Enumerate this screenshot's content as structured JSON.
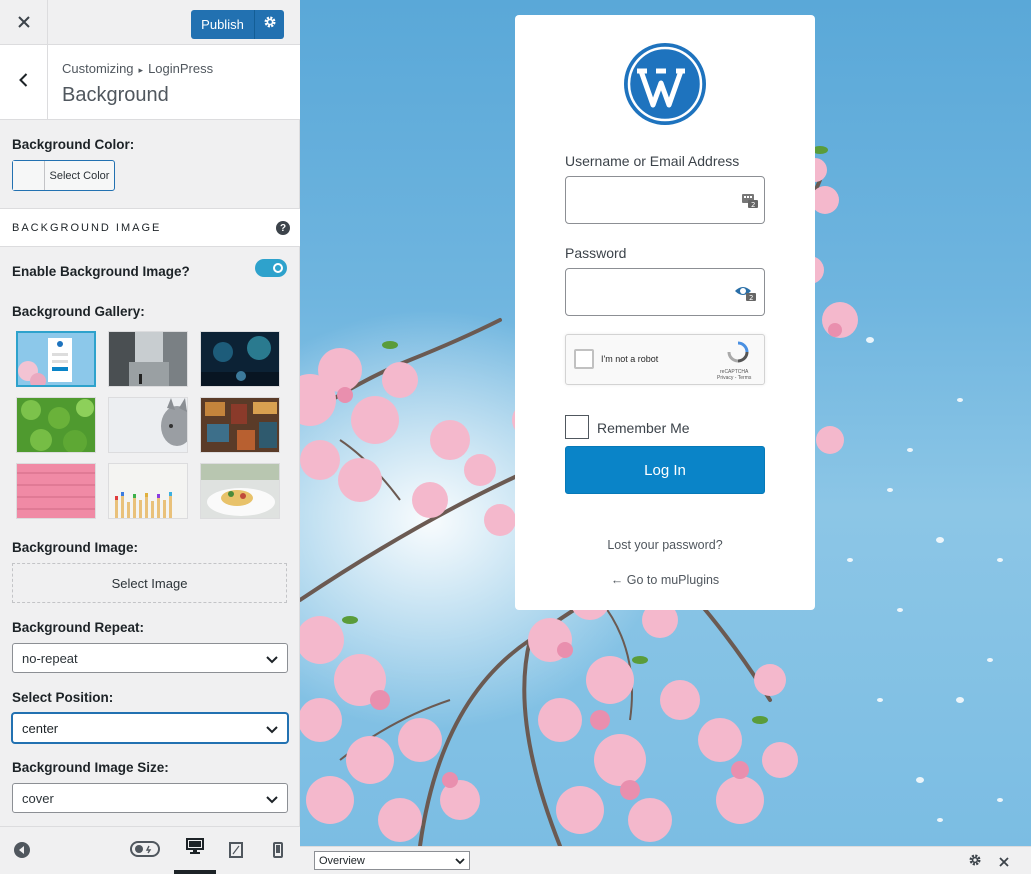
{
  "topbar": {
    "close_icon": "close-icon",
    "publish_label": "Publish",
    "settings_icon": "gear-icon"
  },
  "section": {
    "breadcrumb_parent": "Customizing",
    "breadcrumb_child": "LoginPress",
    "title": "Background"
  },
  "controls": {
    "background_color_label": "Background Color:",
    "select_color_label": "Select Color",
    "background_image_section": "BACKGROUND IMAGE",
    "enable_bg_label": "Enable Background Image?",
    "enable_bg_on": true,
    "gallery_label": "Background Gallery:",
    "gallery_selected_index": 0,
    "background_image_label": "Background Image:",
    "select_image_label": "Select Image",
    "repeat_label": "Background Repeat:",
    "repeat_value": "no-repeat",
    "position_label": "Select Position:",
    "position_value": "center",
    "size_label": "Background Image Size:",
    "size_value": "cover"
  },
  "footer": {
    "icons": [
      "collapse-icon",
      "toggle-icon",
      "desktop-icon",
      "tablet-icon",
      "mobile-icon"
    ],
    "active_device": "desktop"
  },
  "login": {
    "username_label": "Username or Email Address",
    "password_label": "Password",
    "captcha_text": "I'm not a robot",
    "captcha_brand": "reCAPTCHA",
    "captcha_links": "Privacy - Terms",
    "remember_label": "Remember Me",
    "login_button": "Log In",
    "lost_password": "Lost your password?",
    "go_to": "← Go to muPlugins"
  },
  "bottombar": {
    "select_value": "Overview"
  },
  "colors": {
    "accent": "#2271b1",
    "login_button": "#0a84c8",
    "toggle_on": "#2ea2cc",
    "wp_logo": "#1e73be"
  }
}
